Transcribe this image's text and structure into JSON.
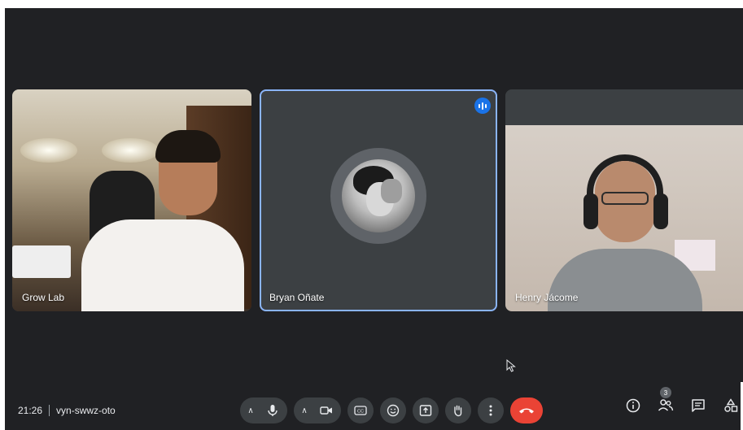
{
  "tiles": [
    {
      "name": "Grow Lab"
    },
    {
      "name": "Bryan Oñate",
      "speaking": true
    },
    {
      "name": "Henry Jácome"
    }
  ],
  "meeting": {
    "time": "21:26",
    "code": "vyn-swwz-oto"
  },
  "controls": {
    "mic_icon": "microphone-icon",
    "camera_icon": "camera-icon",
    "captions_icon": "closed-captions-icon",
    "reactions_icon": "emoji-icon",
    "present_icon": "present-screen-icon",
    "raise_hand_icon": "raise-hand-icon",
    "more_icon": "more-options-icon",
    "end_call_icon": "end-call-icon"
  },
  "side_controls": {
    "info_icon": "info-icon",
    "people_icon": "people-icon",
    "participant_count": "3",
    "chat_icon": "chat-icon",
    "activities_icon": "activities-icon"
  },
  "colors": {
    "background": "#202124",
    "control_bg": "#3c4043",
    "end_call": "#ea4335",
    "speaking_blue": "#1a73e8",
    "active_border": "#8ab4f8"
  }
}
